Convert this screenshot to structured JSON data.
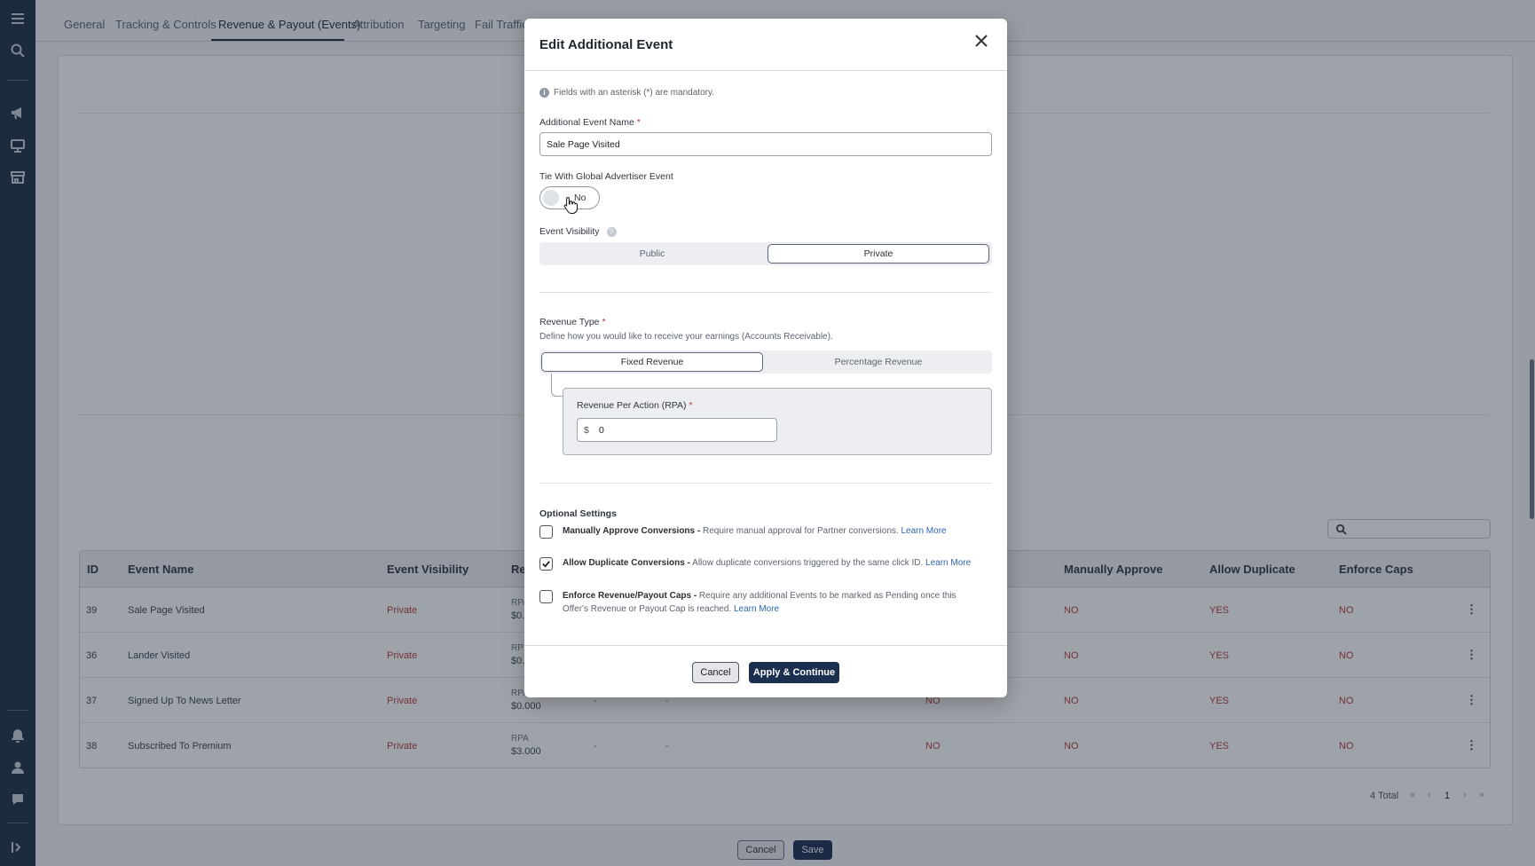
{
  "sidebar": {
    "icons": [
      "menu-icon",
      "search-icon",
      "megaphone-icon",
      "monitor-icon",
      "store-icon",
      "bell-icon",
      "user-icon",
      "help-icon",
      "expand-icon"
    ]
  },
  "tabs": [
    {
      "label": "General"
    },
    {
      "label": "Tracking & Controls"
    },
    {
      "label": "Revenue & Payout (Events)"
    },
    {
      "label": "Attribution"
    },
    {
      "label": "Targeting"
    },
    {
      "label": "Fail Traffic"
    }
  ],
  "table": {
    "headers": {
      "id": "ID",
      "event_name": "Event Name",
      "visibility": "Event Visibility",
      "revenue": "Re",
      "manually_approve": "Manually Approve",
      "allow_duplicate": "Allow Duplicate",
      "enforce_caps": "Enforce Caps"
    },
    "rows": [
      {
        "id": "39",
        "name": "Sale Page Visited",
        "visibility": "Private",
        "rev_label": "RPA",
        "rev_value": "$0.",
        "col_a": "",
        "col_b": "",
        "col_c": "",
        "approve": "NO",
        "duplicate": "YES",
        "caps": "NO"
      },
      {
        "id": "36",
        "name": "Lander Visited",
        "visibility": "Private",
        "rev_label": "RP",
        "rev_value": "$0.",
        "col_a": "",
        "col_b": "",
        "col_c": "",
        "approve": "NO",
        "duplicate": "YES",
        "caps": "NO"
      },
      {
        "id": "37",
        "name": "Signed Up To News Letter",
        "visibility": "Private",
        "rev_label": "RPA",
        "rev_value": "$0.000",
        "col_a": "-",
        "col_b": "-",
        "col_c": "NO",
        "approve": "NO",
        "duplicate": "YES",
        "caps": "NO"
      },
      {
        "id": "38",
        "name": "Subscribed To Premium",
        "visibility": "Private",
        "rev_label": "RPA",
        "rev_value": "$3.000",
        "col_a": "-",
        "col_b": "-",
        "col_c": "NO",
        "approve": "NO",
        "duplicate": "YES",
        "caps": "NO"
      }
    ]
  },
  "pager": {
    "total": "4 Total",
    "page": "1",
    "first": "«",
    "prev": "‹",
    "next": "›",
    "last": "»"
  },
  "page_footer": {
    "cancel": "Cancel",
    "save": "Save"
  },
  "modal": {
    "title": "Edit Additional Event",
    "info_icon": "i",
    "info": "Fields with an asterisk (*) are mandatory.",
    "event_name_label": "Additional Event Name",
    "required_mark": "*",
    "event_name_value": "Sale Page Visited",
    "tie_label": "Tie With Global Advertiser Event",
    "tie_value": "No",
    "visibility_label": "Event Visibility",
    "help_icon": "?",
    "visibility_options": [
      "Public",
      "Private"
    ],
    "visibility_selected": "Private",
    "revenue_type_label": "Revenue Type",
    "revenue_type_desc": "Define how you would like to receive your earnings (Accounts Receivable).",
    "revenue_options": [
      "Fixed Revenue",
      "Percentage Revenue"
    ],
    "revenue_selected": "Fixed Revenue",
    "rpa_label": "Revenue Per Action (RPA)",
    "rpa_prefix": "$",
    "rpa_value": "0",
    "optional_title": "Optional Settings",
    "options": [
      {
        "title": "Manually Approve Conversions -",
        "desc": " Require manual approval for Partner conversions. ",
        "link": "Learn More",
        "checked": false
      },
      {
        "title": "Allow Duplicate Conversions -",
        "desc": " Allow duplicate conversions triggered by the same click ID. ",
        "link": "Learn More",
        "checked": true
      },
      {
        "title": "Enforce Revenue/Payout Caps -",
        "desc": " Require any additional Events to be marked as Pending once this Offer's Revenue or Payout Cap is reached. ",
        "link": "Learn More",
        "checked": false
      }
    ],
    "cancel": "Cancel",
    "apply": "Apply & Continue"
  },
  "colors": {
    "sidebar": "#1d2e45",
    "primary_button": "#1c2f4f",
    "link": "#2c67b3",
    "negative_text": "#b53a3a"
  }
}
